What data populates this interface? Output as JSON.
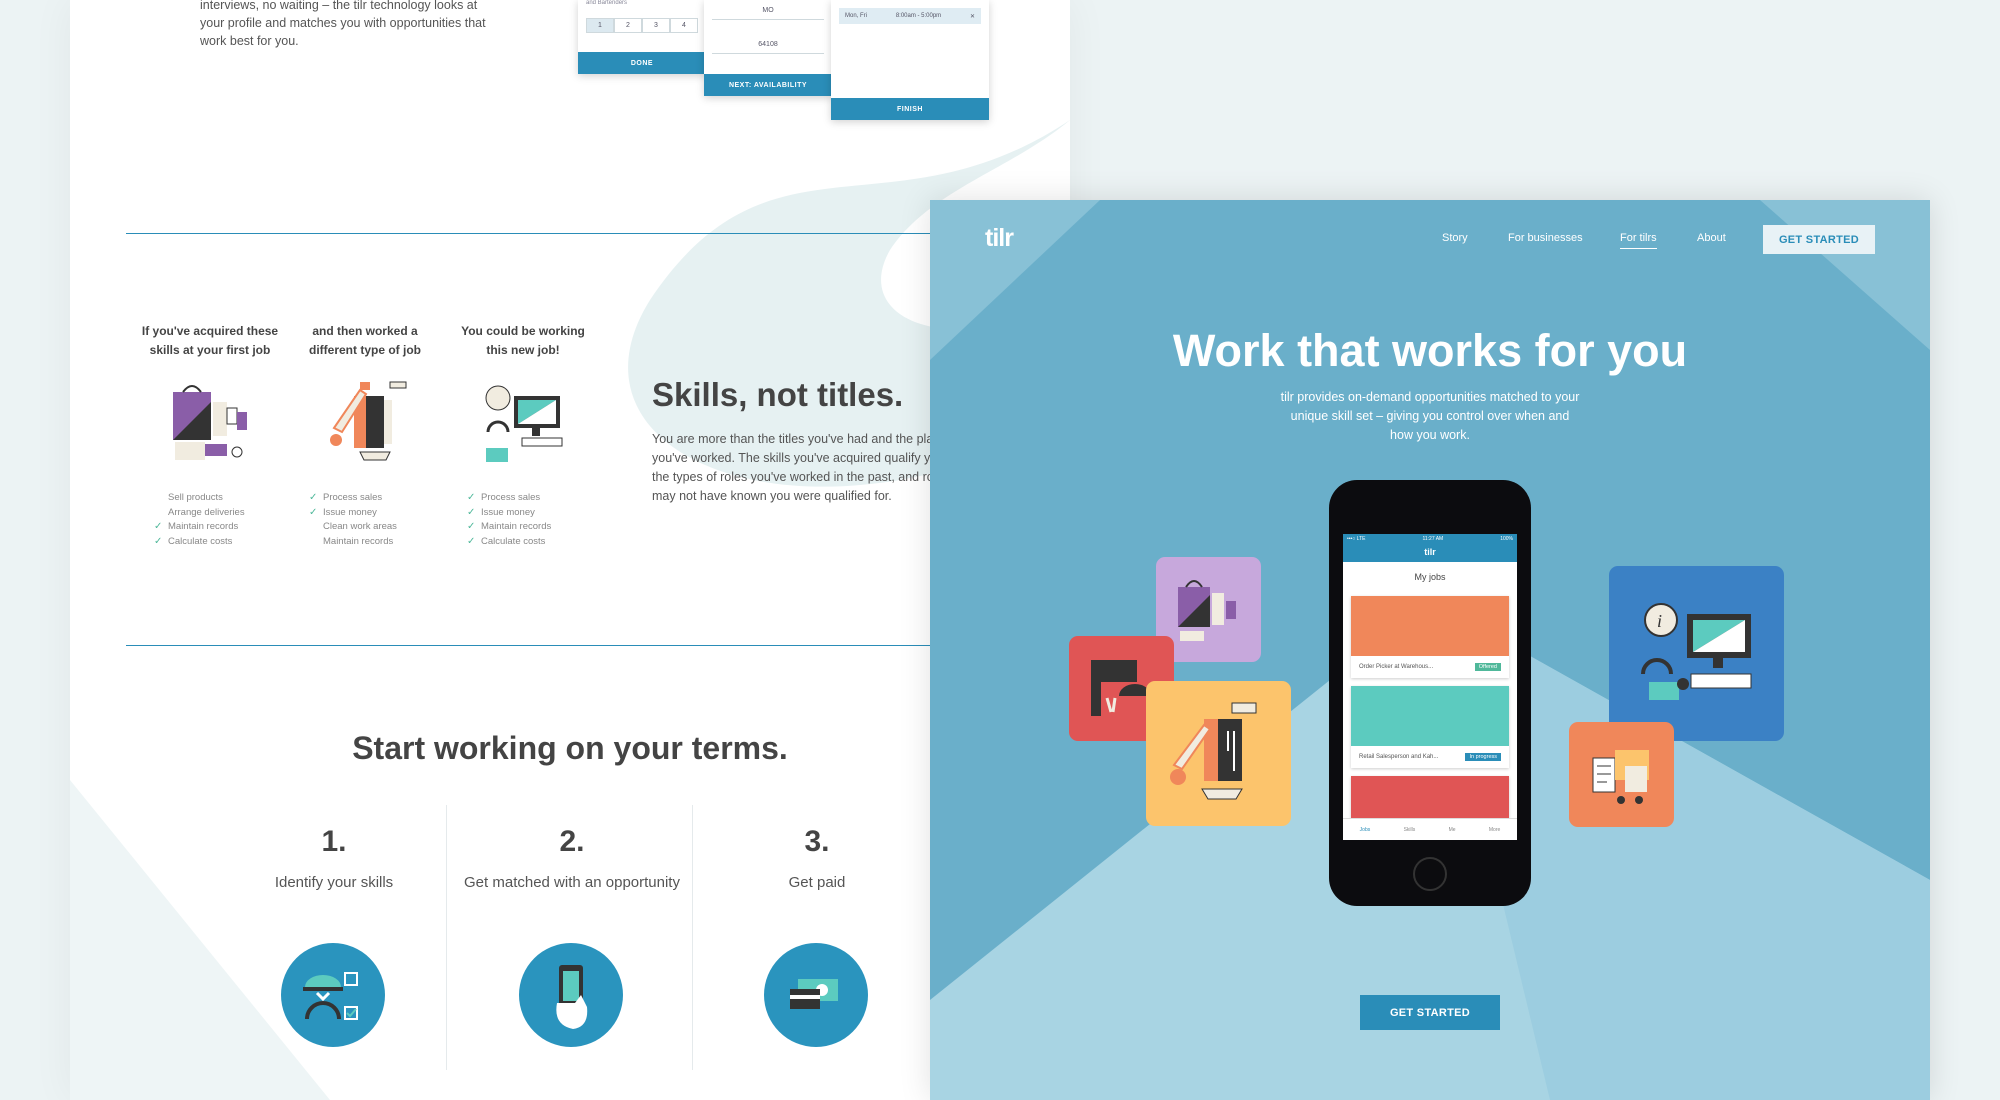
{
  "left": {
    "intro_text": "interviews, no waiting – the tilr technology looks at your profile and matches you with opportunities that work best for you.",
    "onboarding": {
      "card1": {
        "subtitle": "and Bartenders",
        "numbers": [
          "1",
          "2",
          "3",
          "4"
        ],
        "button": "DONE"
      },
      "card2": {
        "field1": "MO",
        "field2": "64108",
        "button": "NEXT: AVAILABILITY"
      },
      "card3": {
        "slot_day": "Mon, Fri",
        "slot_time": "8:00am - 5:00pm",
        "slot_remove": "✕",
        "button": "FINISH"
      }
    },
    "skill_columns": [
      {
        "heading": "If you've acquired these skills at your first job",
        "items": [
          {
            "text": "Sell products",
            "checked": false
          },
          {
            "text": "Arrange deliveries",
            "checked": false
          },
          {
            "text": "Maintain records",
            "checked": true
          },
          {
            "text": "Calculate costs",
            "checked": true
          }
        ]
      },
      {
        "heading": "and then worked a different type of job",
        "items": [
          {
            "text": "Process sales",
            "checked": true
          },
          {
            "text": "Issue money",
            "checked": true
          },
          {
            "text": "Clean work areas",
            "checked": false
          },
          {
            "text": "Maintain records",
            "checked": false
          }
        ]
      },
      {
        "heading": "You could be working this new job!",
        "items": [
          {
            "text": "Process sales",
            "checked": true
          },
          {
            "text": "Issue money",
            "checked": true
          },
          {
            "text": "Maintain records",
            "checked": true
          },
          {
            "text": "Calculate costs",
            "checked": true
          }
        ]
      }
    ],
    "skills_title": "Skills, not titles.",
    "skills_desc": "You are more than the titles you've had and the places you've worked. The skills you've acquired qualify you for the types of roles you've worked in the past, and roles you may not have known you were qualified for.",
    "start_title": "Start working on your terms.",
    "steps": [
      {
        "num": "1.",
        "label": "Identify your skills"
      },
      {
        "num": "2.",
        "label": "Get matched with an opportunity"
      },
      {
        "num": "3.",
        "label": "Get paid"
      }
    ]
  },
  "right": {
    "logo": "tilr",
    "nav": [
      {
        "label": "Story",
        "active": false
      },
      {
        "label": "For businesses",
        "active": false
      },
      {
        "label": "For tilrs",
        "active": true
      },
      {
        "label": "About",
        "active": false
      }
    ],
    "cta_top": "GET STARTED",
    "hero_title": "Work that works for you",
    "hero_sub": "tilr provides on-demand opportunities matched to your unique skill set – giving you control over when and how you work.",
    "cta_bottom": "GET STARTED",
    "phone": {
      "status_left": "•••○ LTE",
      "status_time": "11:27 AM",
      "status_right": "100%",
      "app_title": "tilr",
      "screen_title": "My jobs",
      "jobs": [
        {
          "title": "Order Picker at Warehous...",
          "status": "Offered",
          "status_color": "#4fb89a",
          "image_color": "#f0875a"
        },
        {
          "title": "Retail Salesperson and Kah...",
          "status": "In progress",
          "status_color": "#2a8db8",
          "image_color": "#5ccbbf"
        },
        {
          "title": "",
          "status": "",
          "status_color": "#e05555",
          "image_color": "#e05555"
        }
      ],
      "tabs": [
        "Jobs",
        "Skills",
        "Me",
        "More"
      ]
    }
  },
  "colors": {
    "accent": "#2a8db8",
    "hero_bg": "#6aafca",
    "hero_bg_light": "#a8d4e3",
    "green_check": "#4fb89a"
  }
}
